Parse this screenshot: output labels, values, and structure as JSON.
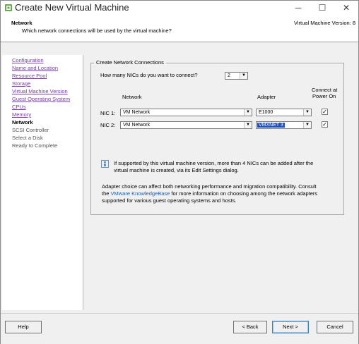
{
  "window": {
    "title": "Create New Virtual Machine",
    "minimize_glyph": "─",
    "maximize_glyph": "☐",
    "close_glyph": "✕"
  },
  "header": {
    "title": "Network",
    "subtitle": "Which network connections will be used by the virtual machine?",
    "version": "Virtual Machine Version: 8"
  },
  "sidebar": {
    "items": [
      {
        "label": "Configuration",
        "state": "link"
      },
      {
        "label": "Name and Location",
        "state": "link"
      },
      {
        "label": "Resource Pool",
        "state": "link"
      },
      {
        "label": "Storage",
        "state": "link"
      },
      {
        "label": "Virtual Machine Version",
        "state": "link"
      },
      {
        "label": "Guest Operating System",
        "state": "link"
      },
      {
        "label": "CPUs",
        "state": "link"
      },
      {
        "label": "Memory",
        "state": "link"
      },
      {
        "label": "Network",
        "state": "current"
      },
      {
        "label": "SCSI Controller",
        "state": "future"
      },
      {
        "label": "Select a Disk",
        "state": "future"
      },
      {
        "label": "Ready to Complete",
        "state": "future"
      }
    ]
  },
  "group": {
    "title": "Create Network Connections",
    "nic_count_label": "How many NICs do you want to connect?",
    "nic_count_value": "2",
    "col_network": "Network",
    "col_adapter": "Adapter",
    "col_connect_line1": "Connect at",
    "col_connect_line2": "Power On",
    "nics": [
      {
        "label": "NIC 1:",
        "network": "VM Network",
        "adapter": "E1000",
        "connect": true
      },
      {
        "label": "NIC 2:",
        "network": "VM Network",
        "adapter": "VMXNET 3",
        "connect": true
      }
    ],
    "info_line1": "If supported by this virtual machine version, more than 4 NICs can be added after the",
    "info_line2": "virtual machine is created, via its Edit Settings dialog.",
    "adapter_line1": "Adapter choice can affect both networking performance and migration compatibility. Consult",
    "adapter_line2_pre": "the ",
    "adapter_line2_link": "VMware KnowledgeBase",
    "adapter_line2_post": " for more information on choosing among the network adapters",
    "adapter_line3": "supported for various guest operating systems and hosts."
  },
  "footer": {
    "help": "Help",
    "back": "< Back",
    "next": "Next >",
    "cancel": "Cancel"
  },
  "colors": {
    "link": "#7a3ba8",
    "selection": "#1c4fb8",
    "kb_link": "#1a5fb4"
  },
  "icons": {
    "app": "vmware-logo-icon",
    "info": "info-icon",
    "checkmark": "✓",
    "dropdown": "▼"
  }
}
